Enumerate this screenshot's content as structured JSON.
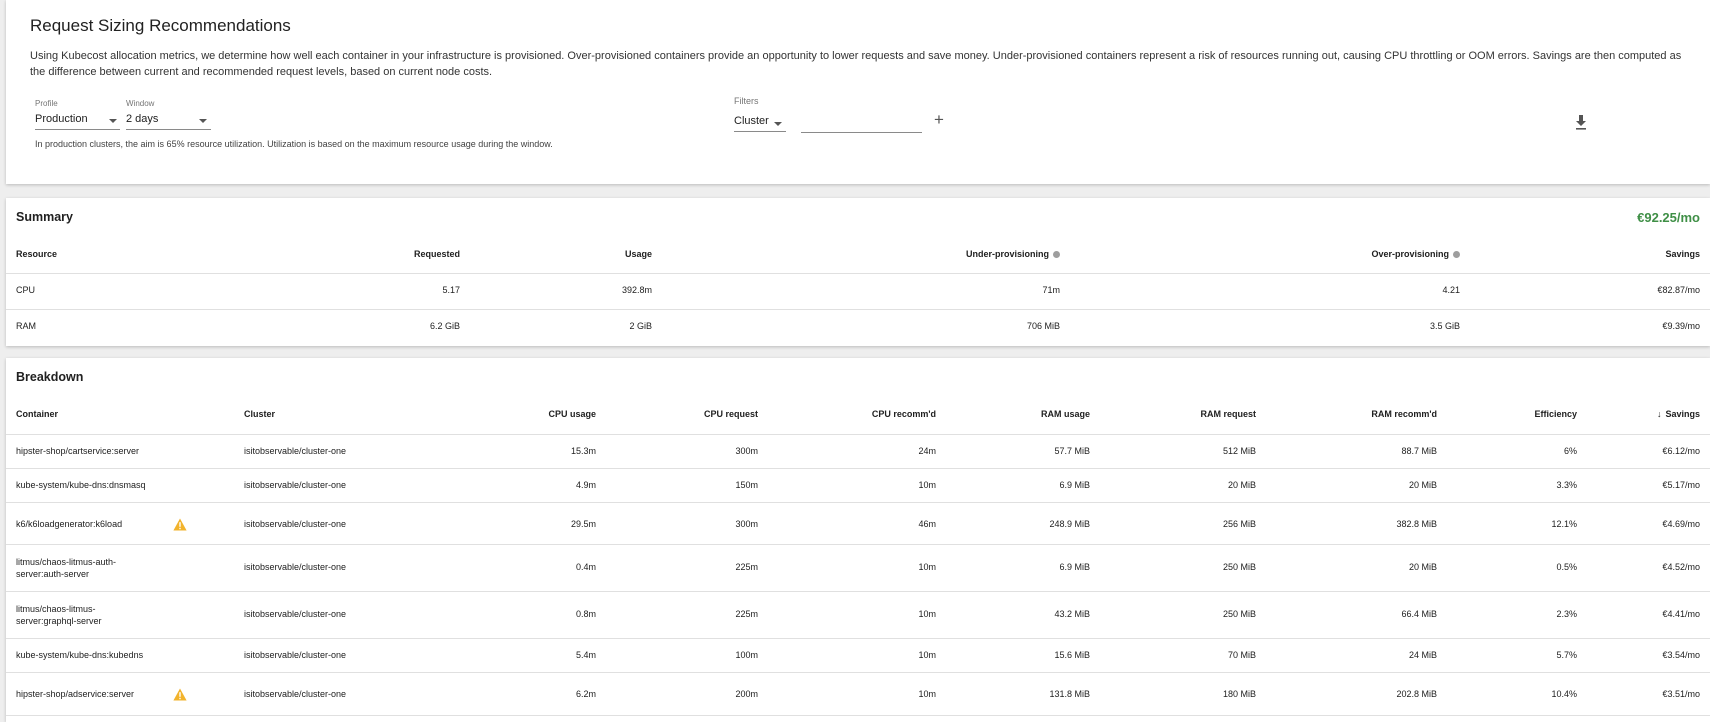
{
  "header": {
    "title": "Request Sizing Recommendations",
    "description": "Using Kubecost allocation metrics, we determine how well each container in your infrastructure is provisioned. Over-provisioned containers provide an opportunity to lower requests and save money. Under-provisioned containers represent a risk of resources running out, causing CPU throttling or OOM errors. Savings are then computed as the difference between current and recommended request levels, based on current node costs.",
    "profile": {
      "label": "Profile",
      "value": "Production"
    },
    "window": {
      "label": "Window",
      "value": "2 days"
    },
    "filters": {
      "label": "Filters",
      "type_value": "Cluster",
      "input_value": "",
      "add_symbol": "+"
    },
    "hint": "In production clusters, the aim is 65% resource utilization. Utilization is based on the maximum resource usage during the window.",
    "icons": {
      "download": "download-icon",
      "add": "plus-icon"
    }
  },
  "summary": {
    "title": "Summary",
    "total_savings": "€92.25/mo",
    "columns": [
      "Resource",
      "Requested",
      "Usage",
      "Under-provisioning",
      "Over-provisioning",
      "Savings"
    ],
    "rows": [
      {
        "resource": "CPU",
        "requested": "5.17",
        "usage": "392.8m",
        "under": "71m",
        "over": "4.21",
        "savings": "€82.87/mo"
      },
      {
        "resource": "RAM",
        "requested": "6.2 GiB",
        "usage": "2 GiB",
        "under": "706 MiB",
        "over": "3.5 GiB",
        "savings": "€9.39/mo"
      }
    ]
  },
  "breakdown": {
    "title": "Breakdown",
    "sort_indicator": "↓",
    "columns": [
      "Container",
      "Cluster",
      "CPU usage",
      "CPU request",
      "CPU recomm'd",
      "RAM usage",
      "RAM request",
      "RAM recomm'd",
      "Efficiency",
      "Savings"
    ],
    "rows": [
      {
        "container": "hipster-shop/cartservice:server",
        "cluster": "isitobservable/cluster-one",
        "cpu_usage": "15.3m",
        "cpu_request": "300m",
        "cpu_rec": "24m",
        "ram_usage": "57.7 MiB",
        "ram_request": "512 MiB",
        "ram_rec": "88.7 MiB",
        "efficiency": "6%",
        "savings": "€6.12/mo",
        "warning": false
      },
      {
        "container": "kube-system/kube-dns:dnsmasq",
        "cluster": "isitobservable/cluster-one",
        "cpu_usage": "4.9m",
        "cpu_request": "150m",
        "cpu_rec": "10m",
        "ram_usage": "6.9 MiB",
        "ram_request": "20 MiB",
        "ram_rec": "20 MiB",
        "efficiency": "3.3%",
        "savings": "€5.17/mo",
        "warning": false
      },
      {
        "container": "k6/k6loadgenerator:k6load",
        "cluster": "isitobservable/cluster-one",
        "cpu_usage": "29.5m",
        "cpu_request": "300m",
        "cpu_rec": "46m",
        "ram_usage": "248.9 MiB",
        "ram_request": "256 MiB",
        "ram_rec": "382.8 MiB",
        "efficiency": "12.1%",
        "savings": "€4.69/mo",
        "warning": true
      },
      {
        "container": "litmus/chaos-litmus-auth-server:auth-server",
        "cluster": "isitobservable/cluster-one",
        "cpu_usage": "0.4m",
        "cpu_request": "225m",
        "cpu_rec": "10m",
        "ram_usage": "6.9 MiB",
        "ram_request": "250 MiB",
        "ram_rec": "20 MiB",
        "efficiency": "0.5%",
        "savings": "€4.52/mo",
        "warning": false
      },
      {
        "container": "litmus/chaos-litmus-server:graphql-server",
        "cluster": "isitobservable/cluster-one",
        "cpu_usage": "0.8m",
        "cpu_request": "225m",
        "cpu_rec": "10m",
        "ram_usage": "43.2 MiB",
        "ram_request": "250 MiB",
        "ram_rec": "66.4 MiB",
        "efficiency": "2.3%",
        "savings": "€4.41/mo",
        "warning": false
      },
      {
        "container": "kube-system/kube-dns:kubedns",
        "cluster": "isitobservable/cluster-one",
        "cpu_usage": "5.4m",
        "cpu_request": "100m",
        "cpu_rec": "10m",
        "ram_usage": "15.6 MiB",
        "ram_request": "70 MiB",
        "ram_rec": "24 MiB",
        "efficiency": "5.7%",
        "savings": "€3.54/mo",
        "warning": false
      },
      {
        "container": "hipster-shop/adservice:server",
        "cluster": "isitobservable/cluster-one",
        "cpu_usage": "6.2m",
        "cpu_request": "200m",
        "cpu_rec": "10m",
        "ram_usage": "131.8 MiB",
        "ram_request": "180 MiB",
        "ram_rec": "202.8 MiB",
        "efficiency": "10.4%",
        "savings": "€3.51/mo",
        "warning": true
      }
    ]
  },
  "colors": {
    "accent_green": "#3f8f46",
    "warning": "#f2b32c",
    "divider": "#e0e0e0"
  }
}
